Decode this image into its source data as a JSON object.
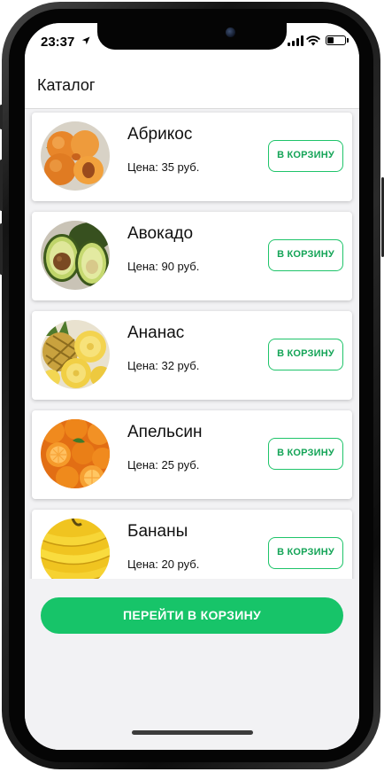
{
  "status_bar": {
    "time": "23:37"
  },
  "header": {
    "title": "Каталог"
  },
  "products": [
    {
      "name": "Абрикос",
      "price": "Цена: 35 руб.",
      "button": "В КОРЗИНУ",
      "image": "apricot-image"
    },
    {
      "name": "Авокадо",
      "price": "Цена: 90 руб.",
      "button": "В КОРЗИНУ",
      "image": "avocado-image"
    },
    {
      "name": "Ананас",
      "price": "Цена: 32 руб.",
      "button": "В КОРЗИНУ",
      "image": "pineapple-image"
    },
    {
      "name": "Апельсин",
      "price": "Цена: 25 руб.",
      "button": "В КОРЗИНУ",
      "image": "orange-image"
    },
    {
      "name": "Бананы",
      "price": "Цена: 20 руб.",
      "button": "В КОРЗИНУ",
      "image": "banana-image"
    }
  ],
  "footer": {
    "go_to_cart": "ПЕРЕЙТИ В КОРЗИНУ"
  },
  "colors": {
    "accent": "#17c469",
    "button_border": "#1fc46a",
    "button_text": "#14a457",
    "background": "#f2f2f4"
  }
}
